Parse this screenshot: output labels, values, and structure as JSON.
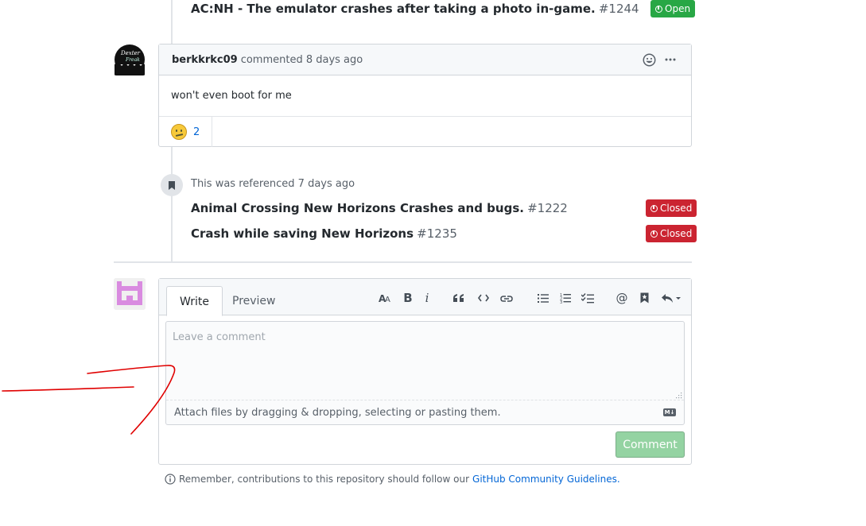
{
  "top_reference": {
    "title": "AC:NH - The emulator crashes after taking a photo in-game.",
    "number": "#1244",
    "state": "Open"
  },
  "comment": {
    "author": "berkkrkc09",
    "meta": "commented 8 days ago",
    "body": "won't even boot for me",
    "reactions": [
      {
        "icon": "confused-emoji-icon",
        "count": "2"
      }
    ]
  },
  "reference_event": {
    "text": "This was referenced 7 days ago",
    "items": [
      {
        "title": "Animal Crossing New Horizons Crashes and bugs.",
        "number": "#1222",
        "state": "Closed"
      },
      {
        "title": "Crash while saving New Horizons",
        "number": "#1235",
        "state": "Closed"
      }
    ]
  },
  "editor": {
    "tabs": [
      "Write",
      "Preview"
    ],
    "toolbar": [
      "text-size-icon",
      "bold-icon",
      "italic-icon",
      "quote-icon",
      "code-icon",
      "link-icon",
      "unordered-list-icon",
      "ordered-list-icon",
      "task-list-icon",
      "mention-icon",
      "saved-reply-icon",
      "reply-icon"
    ],
    "toolbar_glyphs": {
      "bold": "B",
      "italic": "i",
      "mention": "@"
    },
    "placeholder": "Leave a comment",
    "attach_text": "Attach files by dragging & dropping, selecting or pasting them.",
    "markdown_badge": "M↓",
    "submit_label": "Comment"
  },
  "footer": {
    "text": "Remember, contributions to this repository should follow our",
    "link": "GitHub Community Guidelines",
    "suffix": "."
  },
  "colors": {
    "open": "#28a745",
    "closed": "#cb2431",
    "annotation": "#e00000",
    "submit_disabled": "#94d3a2"
  }
}
